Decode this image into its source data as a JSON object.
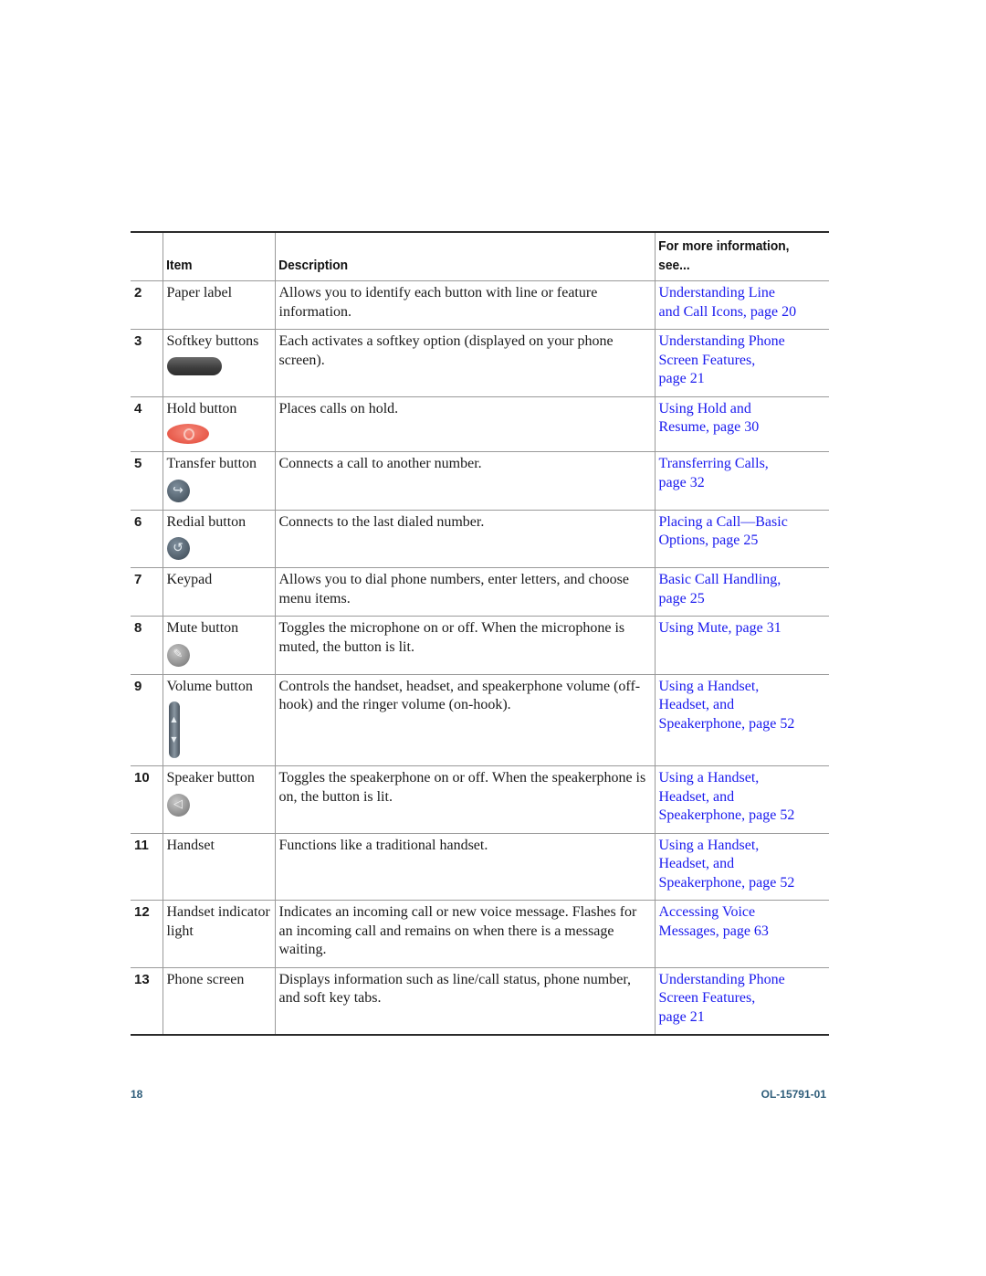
{
  "table": {
    "headers": {
      "num": "",
      "item": "Item",
      "description": "Description",
      "info_line1": "For more information,",
      "info_line2": "see..."
    },
    "rows": [
      {
        "num": "2",
        "item": "Paper label",
        "description": "Allows you to identify each button with line or feature information.",
        "links": [
          "Understanding Line",
          "and Call Icons, page 20"
        ],
        "icon": "none"
      },
      {
        "num": "3",
        "item": "Softkey buttons",
        "description": "Each activates a softkey option (displayed on your phone screen).",
        "links": [
          "Understanding Phone",
          "Screen Features,",
          "page 21"
        ],
        "icon": "softkey-button-icon"
      },
      {
        "num": "4",
        "item": "Hold button",
        "description": "Places calls on hold.",
        "links": [
          "Using Hold and",
          "Resume, page 30"
        ],
        "icon": "hold-button-icon"
      },
      {
        "num": "5",
        "item": "Transfer button",
        "description": "Connects a call to another number.",
        "links": [
          "Transferring Calls,",
          "page 32"
        ],
        "icon": "transfer-button-icon"
      },
      {
        "num": "6",
        "item": "Redial button",
        "description": "Connects to the last dialed number.",
        "links": [
          "Placing a Call—Basic",
          "Options, page 25"
        ],
        "icon": "redial-button-icon"
      },
      {
        "num": "7",
        "item": "Keypad",
        "description": "Allows you to dial phone numbers, enter letters, and choose menu items.",
        "links": [
          "Basic Call Handling,",
          "page 25"
        ],
        "icon": "none"
      },
      {
        "num": "8",
        "item": "Mute button",
        "description": "Toggles the microphone on or off. When the microphone is muted, the button is lit.",
        "links": [
          "Using Mute, page 31"
        ],
        "icon": "mute-button-icon"
      },
      {
        "num": "9",
        "item": "Volume button",
        "description": "Controls the handset, headset, and speakerphone volume (off-hook) and the ringer volume (on-hook).",
        "links": [
          "Using a Handset,",
          "Headset, and",
          "Speakerphone, page 52"
        ],
        "icon": "volume-button-icon"
      },
      {
        "num": "10",
        "item": "Speaker button",
        "description": "Toggles the speakerphone on or off. When the speakerphone is on, the button is lit.",
        "links": [
          "Using a Handset,",
          "Headset, and",
          "Speakerphone, page 52"
        ],
        "icon": "speaker-button-icon"
      },
      {
        "num": "11",
        "item": "Handset",
        "description": "Functions like a traditional handset.",
        "links": [
          "Using a Handset,",
          "Headset, and",
          "Speakerphone, page 52"
        ],
        "icon": "none"
      },
      {
        "num": "12",
        "item": "Handset indicator light",
        "description": "Indicates an incoming call or new voice message. Flashes for an incoming call and remains on when there is a message waiting.",
        "links": [
          "Accessing Voice",
          "Messages, page 63"
        ],
        "icon": "none"
      },
      {
        "num": "13",
        "item": "Phone screen",
        "description": "Displays information such as line/call status, phone number, and soft key tabs.",
        "links": [
          "Understanding Phone",
          "Screen Features,",
          "page 21"
        ],
        "icon": "none"
      }
    ]
  },
  "icons": {
    "transfer_glyph": "↪",
    "redial_glyph": "↺",
    "mute_glyph": "✎",
    "speaker_glyph": "◁",
    "volume_up": "▲",
    "volume_down": "▼"
  },
  "footer": {
    "page_number": "18",
    "doc_id": "OL-15791-01"
  },
  "colors": {
    "link": "#1a1aee",
    "footer": "#2e5d7a",
    "hold_button": "#e85a4a"
  }
}
